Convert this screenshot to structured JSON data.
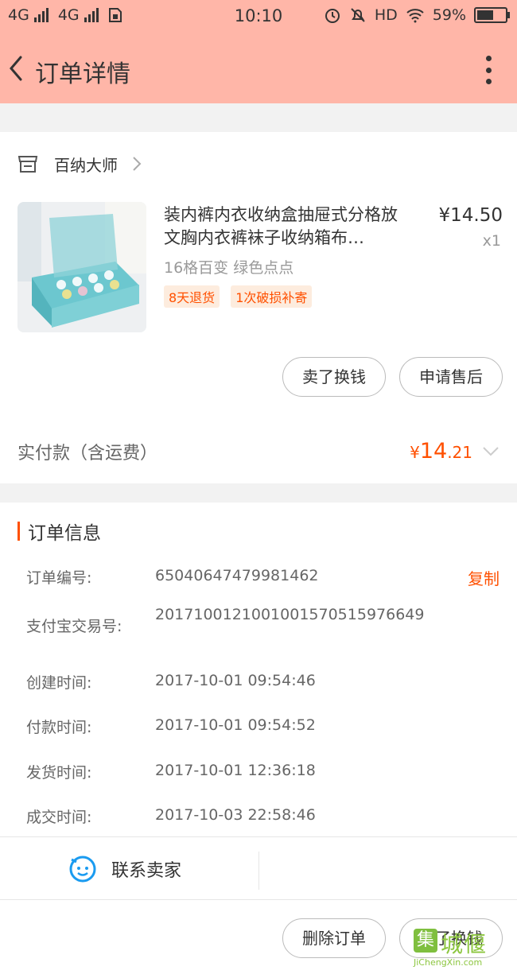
{
  "status_bar": {
    "network_1": "4G",
    "network_2": "4G",
    "time": "10:10",
    "hd_label": "HD",
    "battery": "59%"
  },
  "navbar": {
    "title": "订单详情"
  },
  "shop": {
    "name": "百纳大师"
  },
  "product": {
    "title": "装内裤内衣收纳盒抽屉式分格放文胸内衣裤袜子收纳箱布…",
    "price": "¥14.50",
    "quantity": "x1",
    "spec": "16格百变  绿色点点",
    "tags": [
      "8天退货",
      "1次破损补寄"
    ]
  },
  "actions": {
    "sell": "卖了换钱",
    "after_sale": "申请售后"
  },
  "payment": {
    "label": "实付款（含运费）",
    "currency": "¥",
    "amount_int": "14",
    "amount_dec": ".21"
  },
  "order_info": {
    "heading": "订单信息",
    "copy_label": "复制",
    "rows": [
      {
        "label": "订单编号:",
        "value": "65040647479981462"
      },
      {
        "label": "支付宝交易号:",
        "value": "2017100121001001570515976649"
      },
      {
        "label": "创建时间:",
        "value": "2017-10-01 09:54:46"
      },
      {
        "label": "付款时间:",
        "value": "2017-10-01 09:54:52"
      },
      {
        "label": "发货时间:",
        "value": "2017-10-01 12:36:18"
      },
      {
        "label": "成交时间:",
        "value": "2017-10-03 22:58:46"
      }
    ]
  },
  "footer": {
    "contact": "联系卖家",
    "delete": "删除订单",
    "sell": "卖了换钱"
  },
  "watermark": {
    "char": "集",
    "text": "城偃",
    "url": "JiChengXin.com"
  },
  "colors": {
    "header_bg": "#ffb6a8",
    "accent": "#ff5000",
    "contact_icon": "#1a9bf0"
  }
}
